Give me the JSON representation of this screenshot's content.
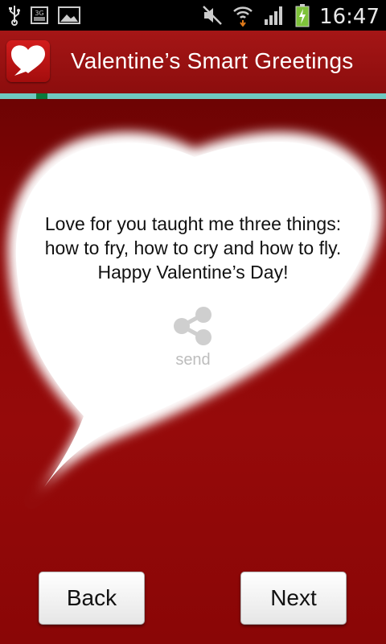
{
  "status_bar": {
    "time": "16:47",
    "icons": [
      "usb-icon",
      "3g-icon",
      "image-icon",
      "mute-icon",
      "wifi-icon",
      "signal-icon",
      "battery-charging-icon"
    ],
    "network_label": "3G"
  },
  "app_bar": {
    "title": "Valentine’s Smart Greetings",
    "icon": "speech-heart-icon"
  },
  "progress": {
    "value": 0.1
  },
  "greeting": {
    "line1": "Love for you taught me three things:",
    "line2": "how to fry, how to cry and how to fly.",
    "line3": "Happy Valentine’s Day!",
    "share_icon": "share-icon",
    "send_label": "send"
  },
  "buttons": {
    "back": "Back",
    "next": "Next"
  },
  "colors": {
    "app_bar": "#a51616",
    "background": "#8e0707",
    "progress_track": "#6fc8c0",
    "progress_fill": "#0a7a3c"
  }
}
